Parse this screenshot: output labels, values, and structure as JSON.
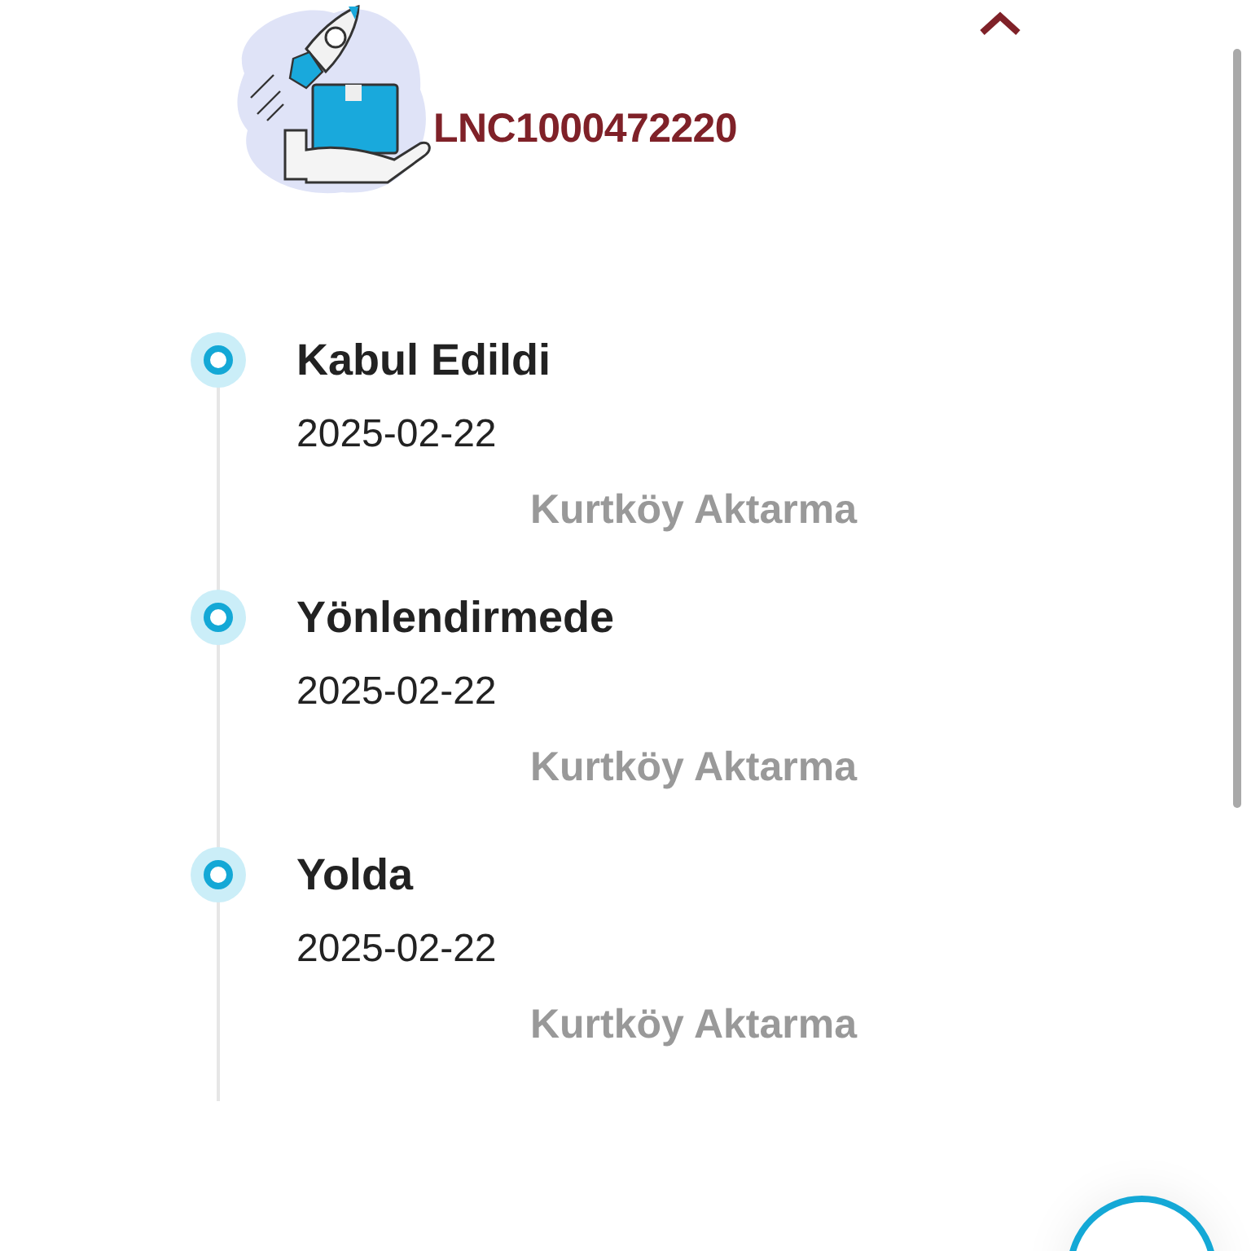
{
  "shipment": {
    "tracking_number": "LNC1000472220",
    "collapse_expanded": true
  },
  "events": [
    {
      "status": "Kabul Edildi",
      "date": "2025-02-22",
      "location": "Kurtköy Aktarma"
    },
    {
      "status": "Yönlendirmede",
      "date": "2025-02-22",
      "location": "Kurtköy Aktarma"
    },
    {
      "status": "Yolda",
      "date": "2025-02-22",
      "location": "Kurtköy Aktarma"
    }
  ]
}
